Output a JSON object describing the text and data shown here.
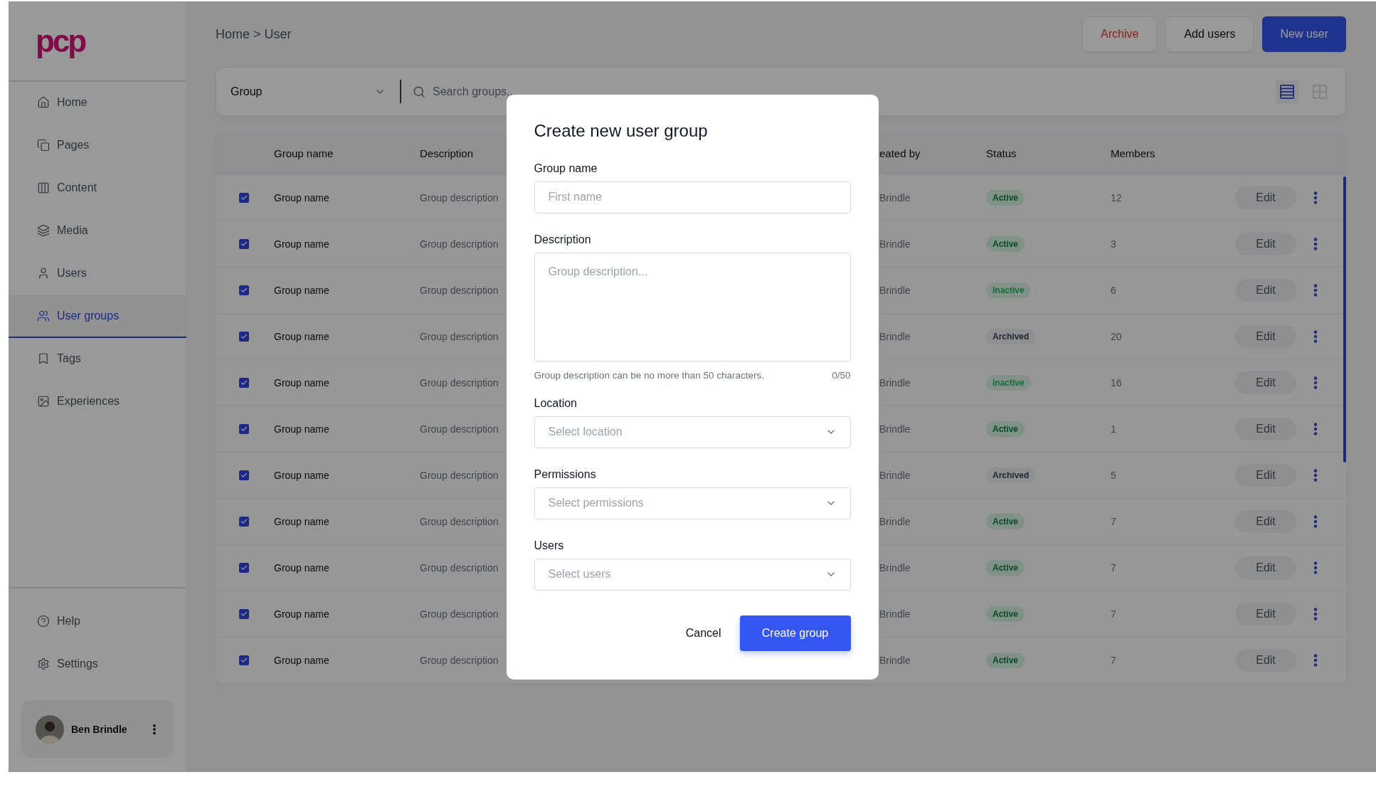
{
  "logo": "pcp",
  "sidebar": {
    "items": [
      {
        "label": "Home",
        "selected": false
      },
      {
        "label": "Pages",
        "selected": false
      },
      {
        "label": "Content",
        "selected": false
      },
      {
        "label": "Media",
        "selected": false
      },
      {
        "label": "Users",
        "selected": false
      },
      {
        "label": "User groups",
        "selected": true
      },
      {
        "label": "Tags",
        "selected": false
      },
      {
        "label": "Experiences",
        "selected": false
      }
    ],
    "footer_items": [
      {
        "label": "Help"
      },
      {
        "label": "Settings"
      }
    ],
    "user": {
      "name": "Ben Brindle"
    }
  },
  "breadcrumb": "Home > User",
  "actions": [
    {
      "label": "Archive",
      "kind": "danger"
    },
    {
      "label": "Add users",
      "kind": "secondary"
    },
    {
      "label": "New user",
      "kind": "primary"
    }
  ],
  "toolbar": {
    "filter": "Group",
    "search": {
      "placeholder": "Search groups..."
    },
    "views": [
      {
        "kind": "list",
        "selected": true
      },
      {
        "kind": "grid",
        "selected": false
      }
    ]
  },
  "table": {
    "columns": [
      "Group name",
      "Description",
      "eated by",
      "Status",
      "Members"
    ],
    "rows": [
      {
        "checked": true,
        "name": "Group name",
        "description": "Group description",
        "created_by": "Brindle",
        "status": "Active",
        "kind": "active",
        "members": "12",
        "action": "Edit"
      },
      {
        "checked": true,
        "name": "Group name",
        "description": "Group description",
        "created_by": "Brindle",
        "status": "Active",
        "kind": "active",
        "members": "3",
        "action": "Edit"
      },
      {
        "checked": true,
        "name": "Group name",
        "description": "Group description",
        "created_by": "Brindle",
        "status": "Inactive",
        "kind": "inactive",
        "members": "6",
        "action": "Edit"
      },
      {
        "checked": true,
        "name": "Group name",
        "description": "Group description",
        "created_by": "Brindle",
        "status": "Archived",
        "kind": "archived",
        "members": "20",
        "action": "Edit"
      },
      {
        "checked": true,
        "name": "Group name",
        "description": "Group description",
        "created_by": "Brindle",
        "status": "Inactive",
        "kind": "inactive",
        "members": "16",
        "action": "Edit"
      },
      {
        "checked": true,
        "name": "Group name",
        "description": "Group description",
        "created_by": "Brindle",
        "status": "Active",
        "kind": "active",
        "members": "1",
        "action": "Edit"
      },
      {
        "checked": true,
        "name": "Group name",
        "description": "Group description",
        "created_by": "Brindle",
        "status": "Archived",
        "kind": "archived",
        "members": "5",
        "action": "Edit"
      },
      {
        "checked": true,
        "name": "Group name",
        "description": "Group description",
        "created_by": "Brindle",
        "status": "Active",
        "kind": "active",
        "members": "7",
        "action": "Edit"
      },
      {
        "checked": true,
        "name": "Group name",
        "description": "Group description",
        "created_by": "Brindle",
        "status": "Active",
        "kind": "active",
        "members": "7",
        "action": "Edit"
      },
      {
        "checked": true,
        "name": "Group name",
        "description": "Group description",
        "created_by": "Brindle",
        "status": "Active",
        "kind": "active",
        "members": "7",
        "action": "Edit"
      },
      {
        "checked": true,
        "name": "Group name",
        "description": "Group description",
        "created_by": "Brindle",
        "status": "Active",
        "kind": "active",
        "members": "7",
        "action": "Edit"
      }
    ]
  },
  "dialog": {
    "title": "Create new user group",
    "fields": [
      {
        "kind": "input",
        "label": "Group name",
        "placeholder": "First name"
      },
      {
        "kind": "textarea",
        "label": "Description",
        "placeholder": "Group description...",
        "hint": "Group description can be no more than 50 characters.",
        "counter": "0/50"
      },
      {
        "kind": "select",
        "label": "Location",
        "placeholder": "Select location"
      },
      {
        "kind": "select",
        "label": "Permissions",
        "placeholder": "Select permissions"
      },
      {
        "kind": "select",
        "label": "Users",
        "placeholder": "Select users"
      }
    ],
    "cancel": "Cancel",
    "submit": "Create group"
  }
}
